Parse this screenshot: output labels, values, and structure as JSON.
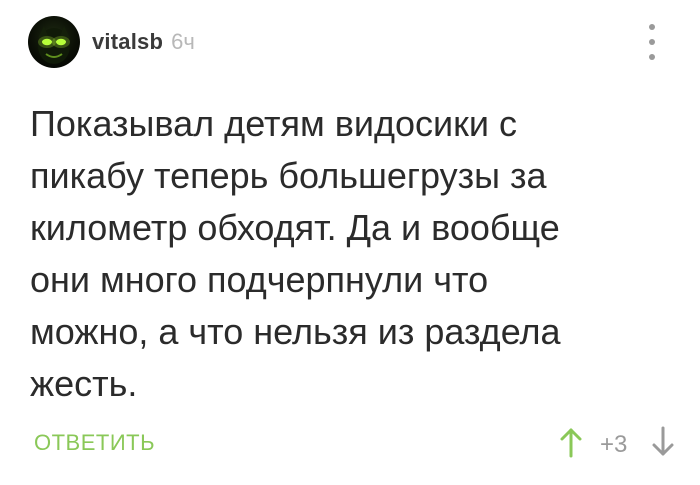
{
  "comment": {
    "author": "vitalsb",
    "time": "6ч",
    "text": "Показывал детям видосики с\nпикабу теперь большегрузы за\nкилометр обходят. Да и вообще\nони много подчерпнули что\nможно, а что нельзя из раздела\nжесть.",
    "reply_label": "ОТВЕТИТЬ",
    "rating": "+3"
  },
  "icons": {
    "avatar": "avatar-glowing-eyes",
    "more": "more-vertical-icon",
    "upvote": "arrow-up-icon",
    "downvote": "arrow-down-icon"
  },
  "colors": {
    "accent": "#8ac858",
    "muted": "#9a9a9a",
    "text": "#2b2b2b",
    "time": "#b8b8b8"
  }
}
